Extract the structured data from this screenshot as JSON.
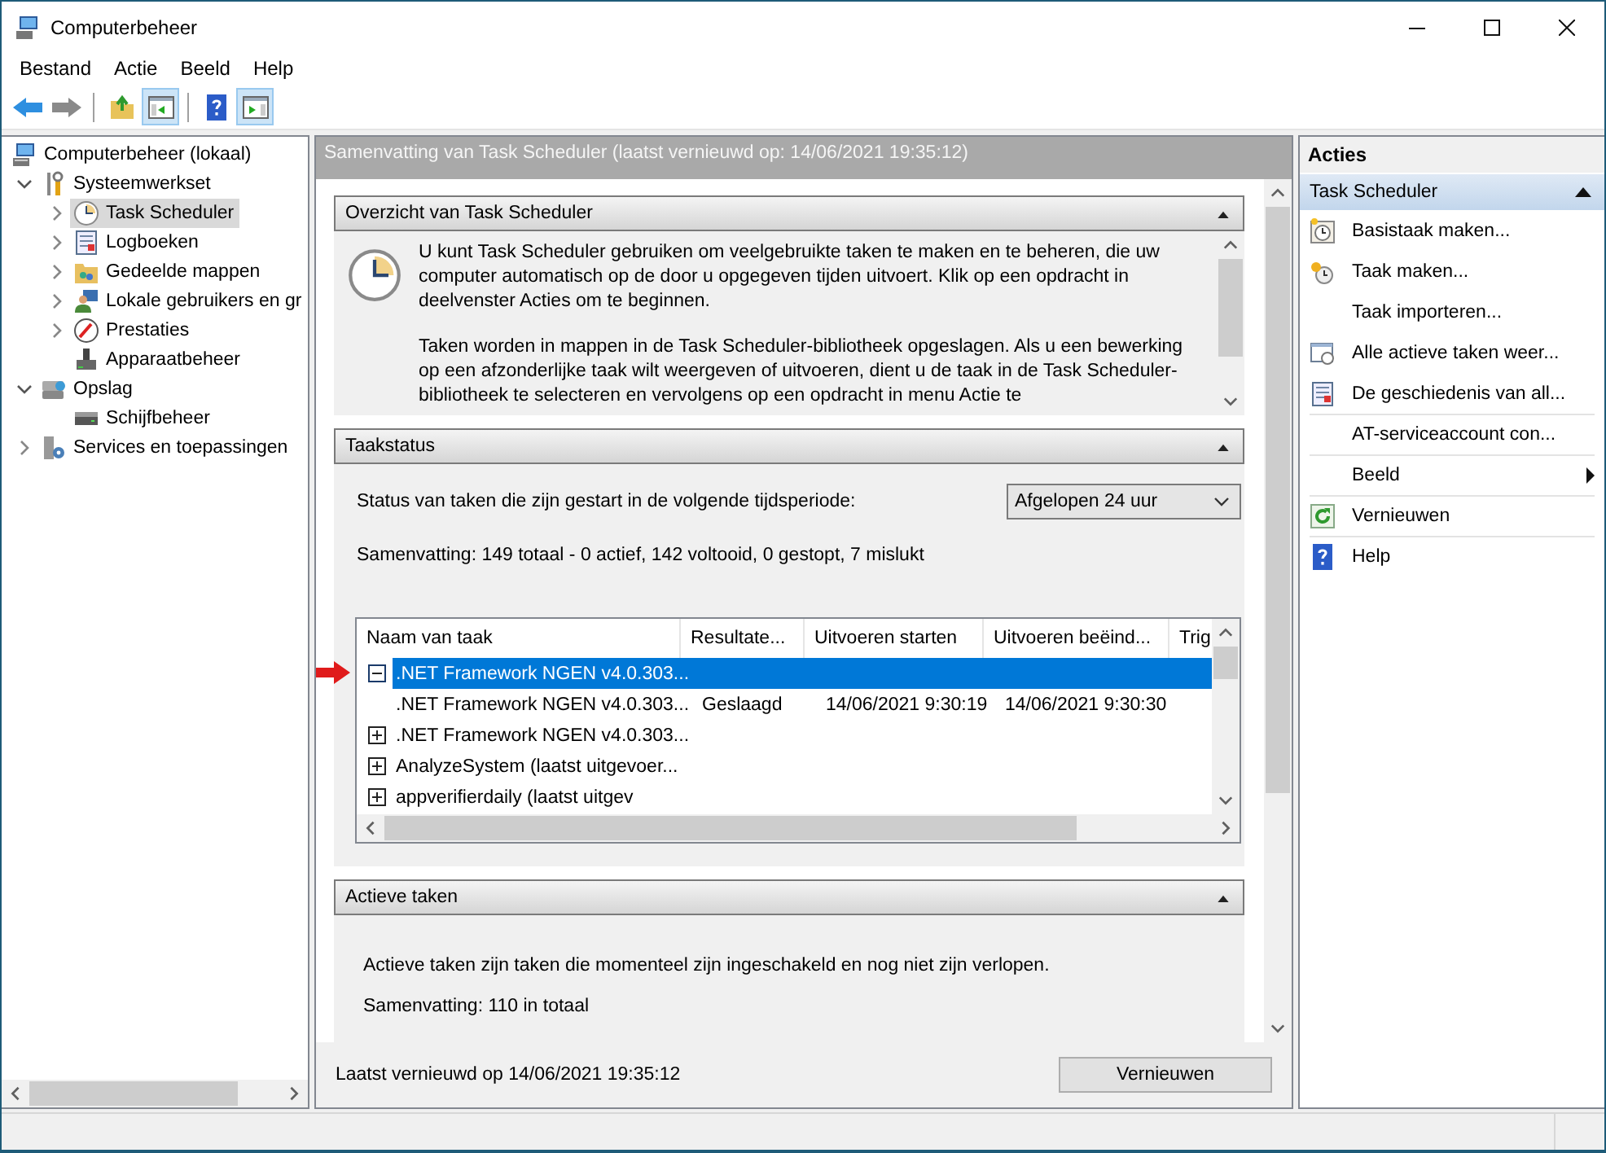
{
  "window": {
    "title": "Computerbeheer"
  },
  "menu": [
    {
      "label": "Bestand"
    },
    {
      "label": "Actie"
    },
    {
      "label": "Beeld"
    },
    {
      "label": "Help"
    }
  ],
  "toolbar": [
    {
      "kind": "back",
      "pressed": false
    },
    {
      "kind": "forward",
      "pressed": false
    },
    {
      "kind": "separator"
    },
    {
      "kind": "up-folder",
      "pressed": false
    },
    {
      "kind": "tree-pane",
      "pressed": true
    },
    {
      "kind": "separator"
    },
    {
      "kind": "help",
      "pressed": false
    },
    {
      "kind": "action-pane",
      "pressed": true
    }
  ],
  "tree": [
    {
      "label": "Computerbeheer (lokaal)",
      "selected": false,
      "children": [
        {
          "label": "Systeemwerkset",
          "expanded": true,
          "selected": false,
          "children": [
            {
              "label": "Task Scheduler",
              "expanded": false,
              "selected": true
            },
            {
              "label": "Logboeken",
              "expanded": false,
              "selected": false
            },
            {
              "label": "Gedeelde mappen",
              "expanded": false,
              "selected": false
            },
            {
              "label": "Lokale gebruikers en gr",
              "expanded": false,
              "selected": false
            },
            {
              "label": "Prestaties",
              "expanded": false,
              "selected": false
            },
            {
              "label": "Apparaatbeheer",
              "selected": false
            }
          ]
        },
        {
          "label": "Opslag",
          "expanded": true,
          "selected": false,
          "children": [
            {
              "label": "Schijfbeheer",
              "selected": false
            }
          ]
        },
        {
          "label": "Services en toepassingen",
          "expanded": false,
          "selected": false
        }
      ]
    }
  ],
  "content": {
    "header": "Samenvatting van Task Scheduler (laatst vernieuwd op: 14/06/2021 19:35:12)",
    "sections": [
      {
        "kind": "overview",
        "title": "Overzicht van Task Scheduler",
        "expanded": true,
        "paragraphs": [
          "U kunt Task Scheduler gebruiken om veelgebruikte taken te maken en te beheren, die uw computer automatisch op de door u opgegeven tijden uitvoert. Klik op een opdracht in deelvenster Acties om te beginnen.",
          "Taken worden in mappen in de Task Scheduler-bibliotheek opgeslagen. Als u een bewerking op een afzonderlijke taak wilt weergeven of uitvoeren, dient u de taak in de Task Scheduler-bibliotheek te selecteren en vervolgens op een opdracht in menu Actie te"
        ]
      },
      {
        "kind": "status",
        "title": "Taakstatus",
        "expanded": true,
        "period_label": "Status van taken die zijn gestart in de volgende tijdsperiode:",
        "period": "Afgelopen 24 uur",
        "summary": "Samenvatting: 149 totaal - 0 actief, 142 voltooid, 0 gestopt, 7 mislukt",
        "table": {
          "columns": [
            "Naam van taak",
            "Resultate...",
            "Uitvoeren starten",
            "Uitvoeren beëind...",
            "Trig"
          ],
          "rows": [
            {
              "name": ".NET Framework NGEN v4.0.303...",
              "expanded": true,
              "selected": true,
              "pointer": true
            },
            {
              "name": ".NET Framework NGEN v4.0.303...",
              "result": "Geslaagd",
              "start": "14/06/2021 9:30:19",
              "end": "14/06/2021 9:30:30",
              "selected": false,
              "pointer": false
            },
            {
              "name": ".NET Framework NGEN v4.0.303...",
              "expanded": false,
              "selected": false,
              "pointer": false
            },
            {
              "name": "AnalyzeSystem (laatst uitgevoer...",
              "expanded": false,
              "selected": false,
              "pointer": false
            },
            {
              "name": "appverifierdaily (laatst uitgev",
              "expanded": false,
              "selected": false,
              "pointer": false
            }
          ]
        }
      },
      {
        "kind": "active",
        "title": "Actieve taken",
        "expanded": true,
        "text": "Actieve taken zijn taken die momenteel zijn ingeschakeld en nog niet zijn verlopen.",
        "summary": "Samenvatting: 110 in totaal"
      }
    ],
    "footer": {
      "refreshed": "Laatst vernieuwd op 14/06/2021 19:35:12",
      "button": "Vernieuwen"
    }
  },
  "actions": {
    "title": "Acties",
    "groups": [
      {
        "title": "Task Scheduler",
        "expanded": true,
        "items": [
          {
            "label": "Basistaak maken...",
            "divider": false,
            "submenu": false
          },
          {
            "label": "Taak maken...",
            "divider": false,
            "submenu": false
          },
          {
            "label": "Taak importeren...",
            "divider": false,
            "submenu": false
          },
          {
            "label": "Alle actieve taken weer...",
            "divider": false,
            "submenu": false
          },
          {
            "label": "De geschiedenis van all...",
            "divider": false,
            "submenu": false
          },
          {
            "label": "AT-serviceaccount con...",
            "divider": true,
            "submenu": false
          },
          {
            "label": "Beeld",
            "divider": true,
            "submenu": true
          },
          {
            "label": "Vernieuwen",
            "divider": true,
            "submenu": false
          },
          {
            "label": "Help",
            "divider": true,
            "submenu": false
          }
        ]
      }
    ]
  }
}
